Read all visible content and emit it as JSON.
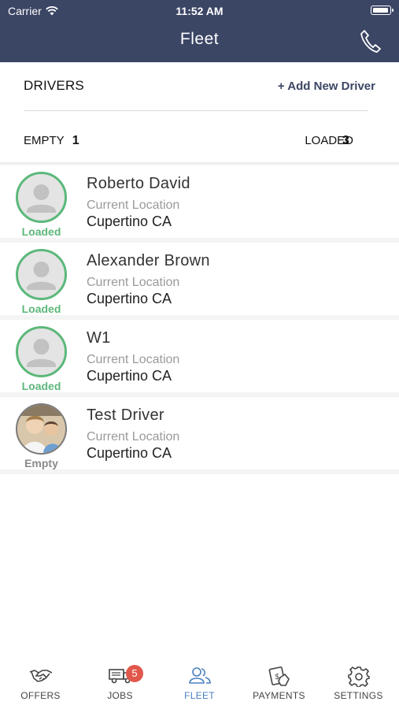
{
  "status_bar": {
    "carrier": "Carrier",
    "time": "11:52 AM"
  },
  "nav": {
    "title": "Fleet",
    "call_icon": "phone-icon"
  },
  "drivers_section": {
    "header": "DRIVERS",
    "add_link": "+ Add New Driver",
    "empty_label": "EMPTY",
    "empty_count": "1",
    "loaded_label": "LOADED",
    "loaded_count": "3"
  },
  "drivers": [
    {
      "name": "Roberto David",
      "status": "Loaded",
      "location_label": "Current Location",
      "location": "Cupertino CA"
    },
    {
      "name": "Alexander Brown",
      "status": "Loaded",
      "location_label": "Current Location",
      "location": "Cupertino CA"
    },
    {
      "name": "W1",
      "status": "Loaded",
      "location_label": "Current Location",
      "location": "Cupertino CA"
    },
    {
      "name": "Test Driver",
      "status": "Empty",
      "location_label": "Current Location",
      "location": "Cupertino CA"
    }
  ],
  "tabs": [
    {
      "label": "OFFERS",
      "icon": "handshake-icon"
    },
    {
      "label": "JOBS",
      "icon": "truck-icon",
      "badge": "5"
    },
    {
      "label": "FLEET",
      "icon": "users-icon",
      "active": true
    },
    {
      "label": "PAYMENTS",
      "icon": "payment-icon"
    },
    {
      "label": "SETTINGS",
      "icon": "gear-icon"
    }
  ],
  "colors": {
    "nav_bg": "#3b4564",
    "loaded_green": "#5cb87a",
    "active_tab": "#4a7fc0",
    "badge_red": "#e2574c"
  }
}
